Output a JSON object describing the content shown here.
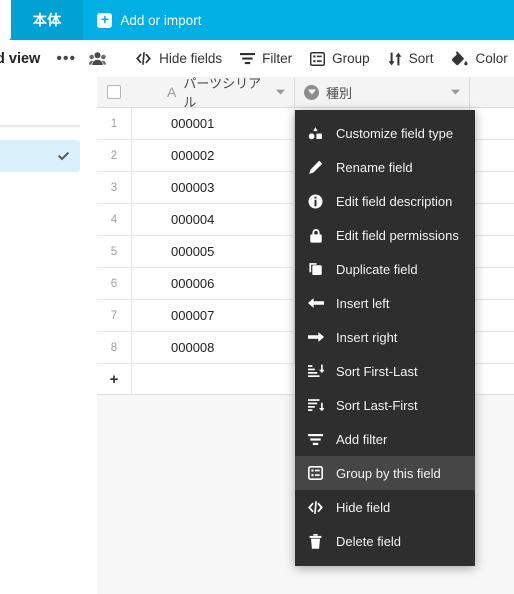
{
  "tabbar": {
    "active_tab": "本体",
    "add_or_import": "Add or import",
    "add_icon": "plus-square-icon",
    "background_color": "#00b0e4",
    "active_tab_color": "#00a2d3"
  },
  "toolbar": {
    "view_name": "d view",
    "more_options": "•••",
    "collaborators_icon": "people-icon",
    "items": [
      {
        "label": "Hide fields",
        "icon": "code-brackets-icon"
      },
      {
        "label": "Filter",
        "icon": "funnel-icon"
      },
      {
        "label": "Group",
        "icon": "group-grid-icon"
      },
      {
        "label": "Sort",
        "icon": "sort-arrows-icon"
      },
      {
        "label": "Color",
        "icon": "paint-bucket-icon"
      }
    ]
  },
  "sidebar": {
    "selected_item_icon": "checkmark-icon",
    "selected_item_color": "#d9f0fb"
  },
  "grid": {
    "select_all_icon": "checkbox-icon",
    "columns": [
      {
        "label": "パーツシリアル",
        "type_icon": "text-field-icon",
        "type_glyph": "A",
        "caret_icon": "chevron-down-icon"
      },
      {
        "label": "種別",
        "type_icon": "single-select-icon",
        "caret_icon": "chevron-down-icon"
      }
    ],
    "rows": [
      {
        "num": "1",
        "c1": "000001",
        "c2": ""
      },
      {
        "num": "2",
        "c1": "000002",
        "c2": ""
      },
      {
        "num": "3",
        "c1": "000003",
        "c2": ""
      },
      {
        "num": "4",
        "c1": "000004",
        "c2": ""
      },
      {
        "num": "5",
        "c1": "000005",
        "c2": ""
      },
      {
        "num": "6",
        "c1": "000006",
        "c2": ""
      },
      {
        "num": "7",
        "c1": "000007",
        "c2": ""
      },
      {
        "num": "8",
        "c1": "000008",
        "c2": ""
      }
    ],
    "add_row_label": "+"
  },
  "context_menu": {
    "background_color": "#2e2e2e",
    "hover_color": "#464646",
    "hovered_item": "Group by this field",
    "items": [
      {
        "label": "Customize field type",
        "icon": "shapes-icon",
        "hover": false
      },
      {
        "label": "Rename field",
        "icon": "pencil-icon",
        "hover": false
      },
      {
        "label": "Edit field description",
        "icon": "info-circle-icon",
        "hover": false
      },
      {
        "label": "Edit field permissions",
        "icon": "lock-icon",
        "hover": false
      },
      {
        "label": "Duplicate field",
        "icon": "duplicate-icon",
        "hover": false
      },
      {
        "label": "Insert left",
        "icon": "arrow-left-icon",
        "hover": false
      },
      {
        "label": "Insert right",
        "icon": "arrow-right-icon",
        "hover": false
      },
      {
        "label": "Sort First-Last",
        "icon": "sort-ascending-icon",
        "hover": false
      },
      {
        "label": "Sort Last-First",
        "icon": "sort-descending-icon",
        "hover": false
      },
      {
        "label": "Add filter",
        "icon": "funnel-icon",
        "hover": false
      },
      {
        "label": "Group by this field",
        "icon": "group-grid-icon",
        "hover": true
      },
      {
        "label": "Hide field",
        "icon": "code-brackets-icon",
        "hover": false
      },
      {
        "label": "Delete field",
        "icon": "trash-icon",
        "hover": false
      }
    ]
  }
}
